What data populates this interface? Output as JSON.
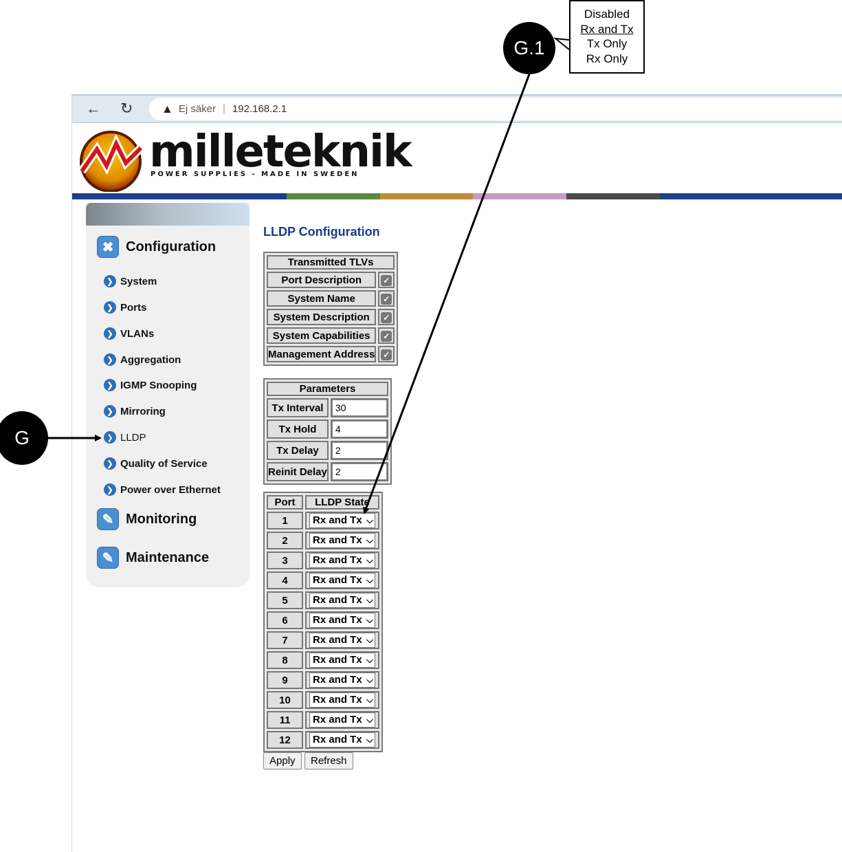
{
  "browser": {
    "back_icon": "arrow-left-icon",
    "reload_icon": "reload-icon",
    "security_label": "Ej säker",
    "separator": "|",
    "url": "192.168.2.1"
  },
  "brand": {
    "name": "milleteknik",
    "tagline": "POWER SUPPLIES - MADE IN SWEDEN",
    "stripe_colors": [
      "#1f3f86",
      "#5a8a3c",
      "#c48c3a",
      "#c79bc6",
      "#4a4a4a",
      "#1f3f86"
    ]
  },
  "sidebar": {
    "configuration": {
      "label": "Configuration",
      "icon": "tools-icon",
      "items": [
        "System",
        "Ports",
        "VLANs",
        "Aggregation",
        "IGMP Snooping",
        "Mirroring",
        "LLDP",
        "Quality of Service",
        "Power over Ethernet"
      ]
    },
    "monitoring": {
      "label": "Monitoring",
      "icon": "monitoring-icon"
    },
    "maintenance": {
      "label": "Maintenance",
      "icon": "maintenance-icon"
    }
  },
  "main": {
    "title": "LLDP Configuration",
    "tlvs": {
      "header": "Transmitted TLVs",
      "rows": [
        {
          "label": "Port Description",
          "checked": true
        },
        {
          "label": "System Name",
          "checked": true
        },
        {
          "label": "System Description",
          "checked": true
        },
        {
          "label": "System Capabilities",
          "checked": true
        },
        {
          "label": "Management Address",
          "checked": true
        }
      ]
    },
    "parameters": {
      "header": "Parameters",
      "rows": [
        {
          "label": "Tx Interval",
          "value": "30"
        },
        {
          "label": "Tx Hold",
          "value": "4"
        },
        {
          "label": "Tx Delay",
          "value": "2"
        },
        {
          "label": "Reinit Delay",
          "value": "2"
        }
      ]
    },
    "ports": {
      "header_port": "Port",
      "header_state": "LLDP State",
      "rows": [
        {
          "port": "1",
          "state": "Rx and Tx"
        },
        {
          "port": "2",
          "state": "Rx and Tx"
        },
        {
          "port": "3",
          "state": "Rx and Tx"
        },
        {
          "port": "4",
          "state": "Rx and Tx"
        },
        {
          "port": "5",
          "state": "Rx and Tx"
        },
        {
          "port": "6",
          "state": "Rx and Tx"
        },
        {
          "port": "7",
          "state": "Rx and Tx"
        },
        {
          "port": "8",
          "state": "Rx and Tx"
        },
        {
          "port": "9",
          "state": "Rx and Tx"
        },
        {
          "port": "10",
          "state": "Rx and Tx"
        },
        {
          "port": "11",
          "state": "Rx and Tx"
        },
        {
          "port": "12",
          "state": "Rx and Tx"
        }
      ]
    },
    "apply_label": "Apply",
    "refresh_label": "Refresh"
  },
  "annotations": {
    "g_label": "G",
    "g1_label": "G.1",
    "state_options": [
      "Disabled",
      "Rx and Tx",
      "Tx Only",
      "Rx Only"
    ]
  }
}
